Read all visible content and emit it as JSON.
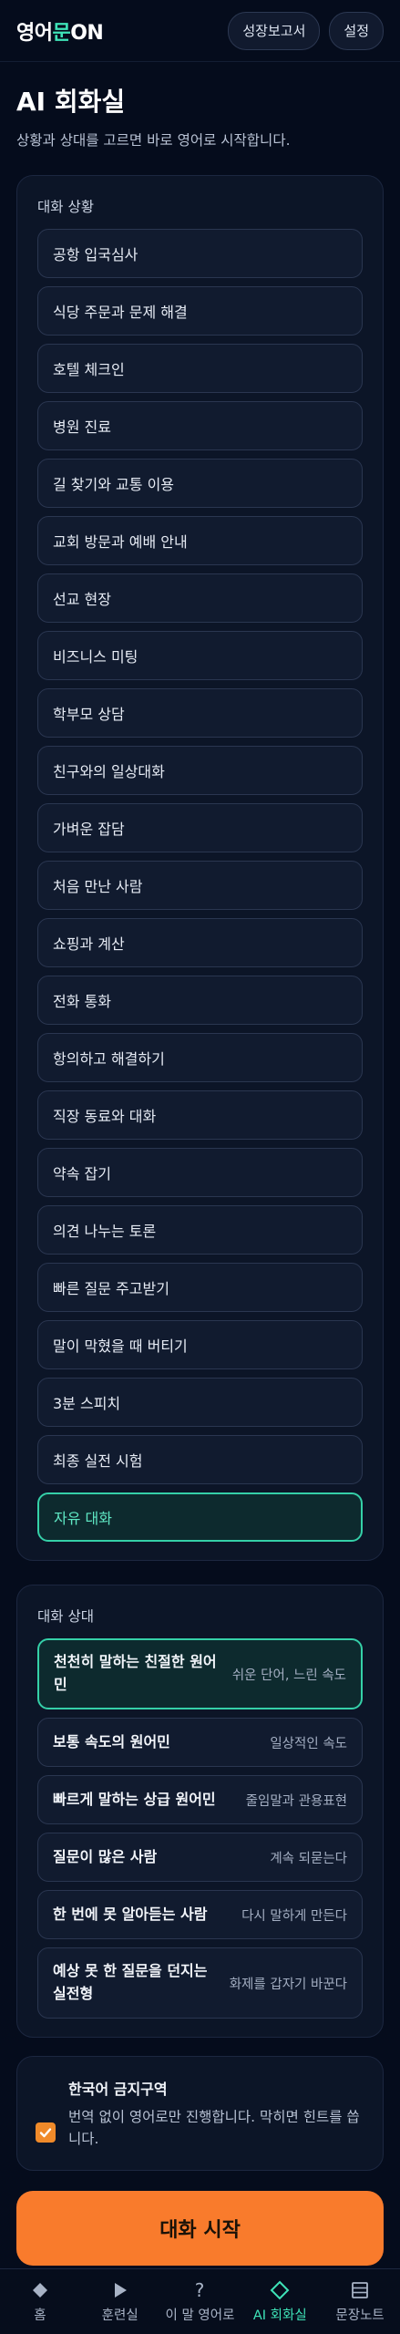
{
  "header": {
    "logo_part1": "영어",
    "logo_part2": "문",
    "logo_part3": "ON",
    "report_btn": "성장보고서",
    "settings_btn": "설정"
  },
  "page": {
    "title": "AI 회화실",
    "subtitle": "상황과 상대를 고르면 바로 영어로 시작합니다."
  },
  "situations": {
    "label": "대화 상황",
    "selected_index": 22,
    "items": [
      "공항 입국심사",
      "식당 주문과 문제 해결",
      "호텔 체크인",
      "병원 진료",
      "길 찾기와 교통 이용",
      "교회 방문과 예배 안내",
      "선교 현장",
      "비즈니스 미팅",
      "학부모 상담",
      "친구와의 일상대화",
      "가벼운 잡담",
      "처음 만난 사람",
      "쇼핑과 계산",
      "전화 통화",
      "항의하고 해결하기",
      "직장 동료와 대화",
      "약속 잡기",
      "의견 나누는 토론",
      "빠른 질문 주고받기",
      "말이 막혔을 때 버티기",
      "3분 스피치",
      "최종 실전 시험",
      "자유 대화"
    ]
  },
  "partners": {
    "label": "대화 상대",
    "selected_index": 0,
    "items": [
      {
        "name": "천천히 말하는 친절한 원어민",
        "desc": "쉬운 단어, 느린 속도"
      },
      {
        "name": "보통 속도의 원어민",
        "desc": "일상적인 속도"
      },
      {
        "name": "빠르게 말하는 상급 원어민",
        "desc": "줄임말과 관용표현"
      },
      {
        "name": "질문이 많은 사람",
        "desc": "계속 되묻는다"
      },
      {
        "name": "한 번에 못 알아듣는 사람",
        "desc": "다시 말하게 만든다"
      },
      {
        "name": "예상 못 한 질문을 던지는 실전형",
        "desc": "화제를 갑자기 바꾼다"
      }
    ]
  },
  "korean_ban": {
    "checked": true,
    "title": "한국어 금지구역",
    "desc": "번역 없이 영어로만 진행합니다. 막히면 힌트를 씁니다."
  },
  "start_button": "대화 시작",
  "colors": {
    "accent": "#3ee3b8",
    "primary_button": "#f97b2c",
    "background": "#050c1c"
  },
  "tabbar": {
    "active_index": 3,
    "tabs": [
      {
        "label": "홈",
        "icon": "diamond-icon"
      },
      {
        "label": "훈련실",
        "icon": "play-icon"
      },
      {
        "label": "이 말 영어로",
        "icon": "question-icon"
      },
      {
        "label": "AI 회화실",
        "icon": "diamond-outline-icon"
      },
      {
        "label": "문장노트",
        "icon": "notes-icon"
      }
    ]
  }
}
